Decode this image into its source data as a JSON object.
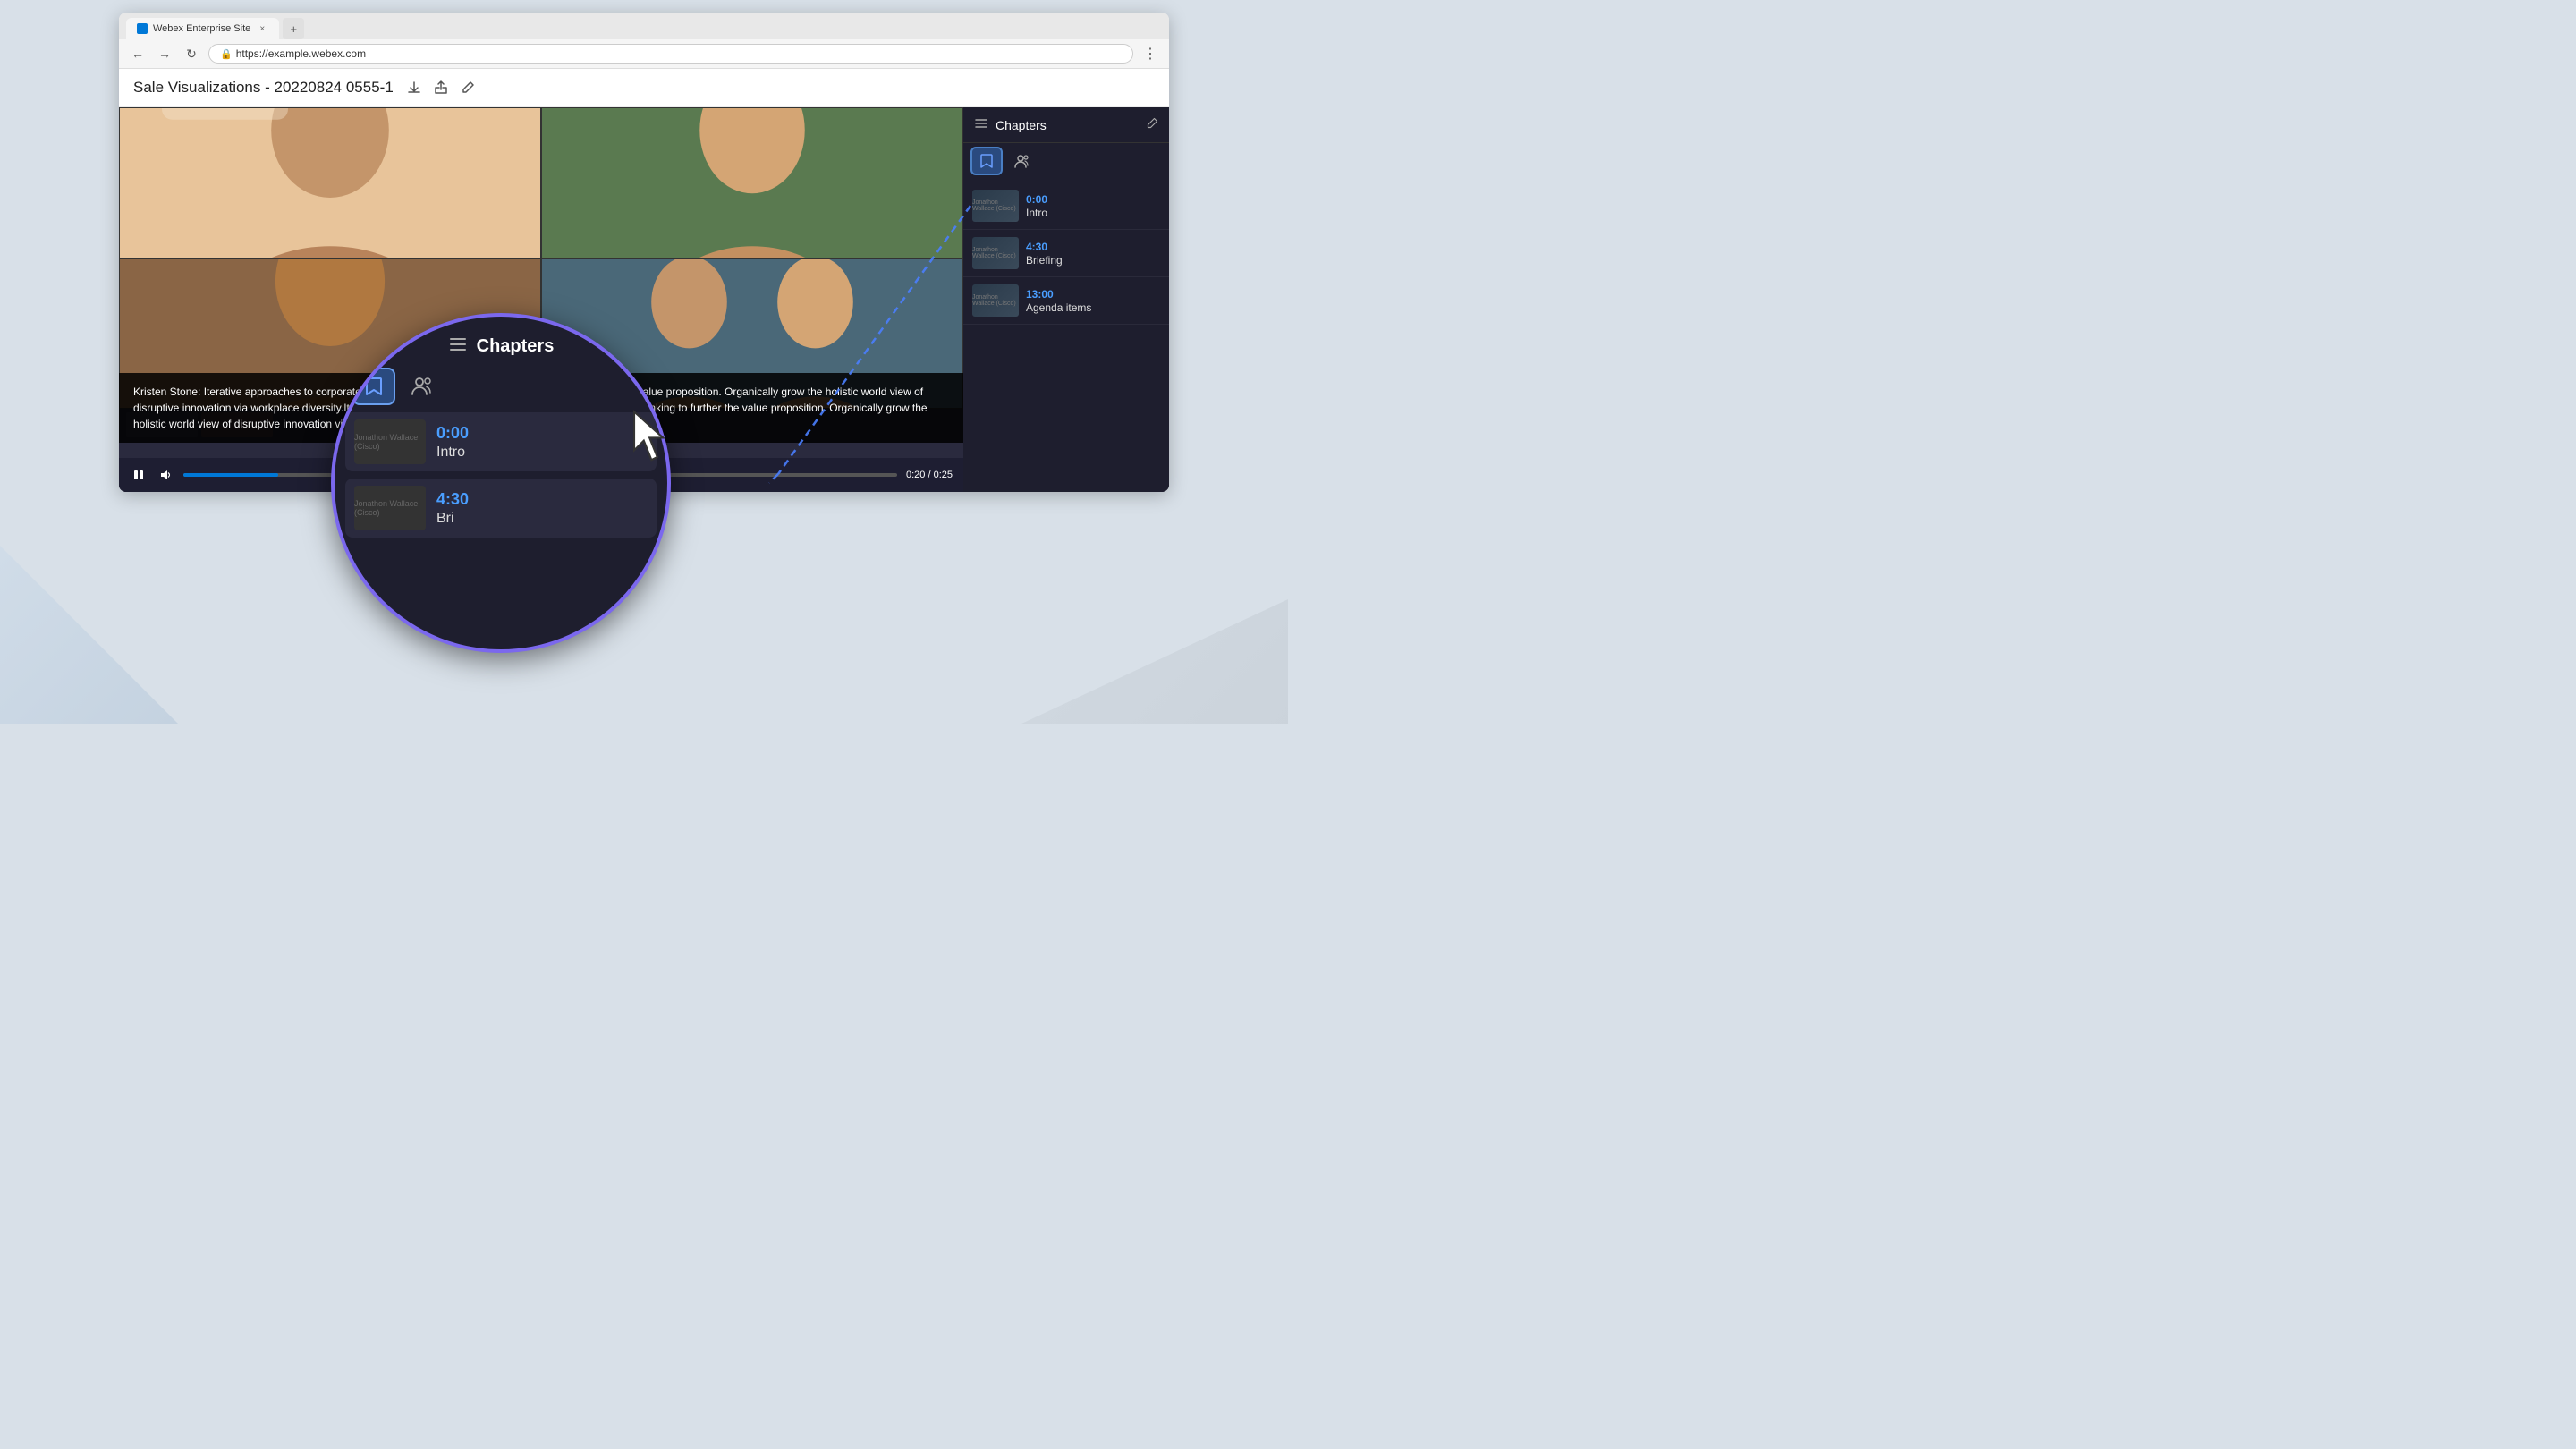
{
  "browser": {
    "tab_label": "Webex Enterprise Site",
    "address": "https://example.webex.com",
    "favicon_label": "webex-favicon"
  },
  "page": {
    "title": "Sale Visualizations - 20220824 0555-1",
    "action_download": "download",
    "action_share": "share",
    "action_edit": "edit"
  },
  "video": {
    "current_time": "0:20",
    "total_time": "0:25",
    "transcript": "Kristen Stone: Iterative approaches to corporate strategy foster collaborative thinking to further the people value proposition. Organically grow the holistic world view of disruptive innovation via workplace diversity.Iterative approaches to corporate strategy foster collaborative thinking to further the value proposition. Organically grow the holistic world view of disruptive innovation via w..."
  },
  "chapters_sidebar": {
    "title": "Chapters",
    "edit_label": "edit chapters",
    "tab_bookmark": "bookmark",
    "tab_participants": "participants",
    "chapters": [
      {
        "time": "0:00",
        "name": "Intro",
        "author": "Jonathon Wallace (Cisco)"
      },
      {
        "time": "4:30",
        "name": "Briefing",
        "author": "Jonathon Wallace (Cisco)"
      },
      {
        "time": "13:00",
        "name": "Agenda items",
        "author": "Jonathon Wallace (Cisco)"
      }
    ]
  },
  "magnify": {
    "title": "Chapters",
    "tab_bookmark": "bookmark",
    "tab_participants": "participants",
    "chapters": [
      {
        "time": "0:00",
        "name": "Intro",
        "author": "Jonathon Wallace (Cisco)"
      },
      {
        "time": "4:30",
        "name": "Bri",
        "author": "Jonathon Wallace (Cisco)"
      }
    ]
  }
}
